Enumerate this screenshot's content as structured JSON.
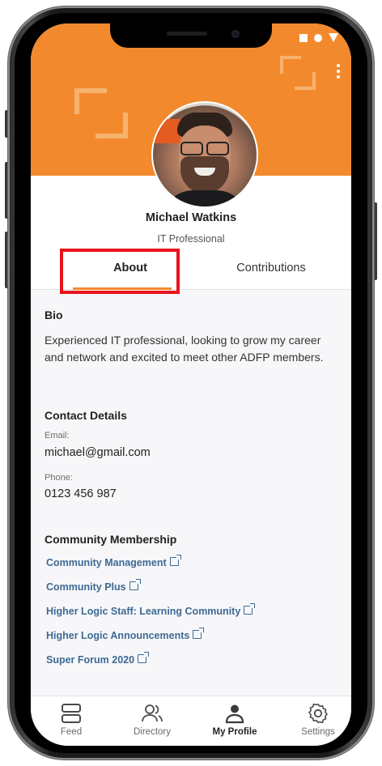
{
  "profile": {
    "name": "Michael Watkins",
    "role": "IT Professional"
  },
  "tabs": {
    "about": "About",
    "contributions": "Contributions",
    "active": "about"
  },
  "bio": {
    "heading": "Bio",
    "text": "Experienced IT professional, looking to grow my career and network and excited to meet other ADFP members."
  },
  "contact": {
    "heading": "Contact Details",
    "email_label": "Email:",
    "email": "michael@gmail.com",
    "phone_label": "Phone:",
    "phone": "0123 456 987"
  },
  "community": {
    "heading": "Community Membership",
    "items": [
      "Community Management",
      "Community Plus",
      "Higher Logic Staff: Learning Community",
      "Higher Logic Announcements",
      "Super Forum 2020"
    ]
  },
  "nav": {
    "feed": "Feed",
    "directory": "Directory",
    "my_profile": "My Profile",
    "settings": "Settings",
    "active": "my_profile"
  },
  "colors": {
    "brand_orange": "#f28a2d",
    "link_blue": "#3d6a94",
    "highlight_red": "#e8141b"
  },
  "icons": [
    "kebab-menu-icon",
    "external-link-icon",
    "feed-icon",
    "directory-icon",
    "profile-icon",
    "settings-gear-icon"
  ]
}
